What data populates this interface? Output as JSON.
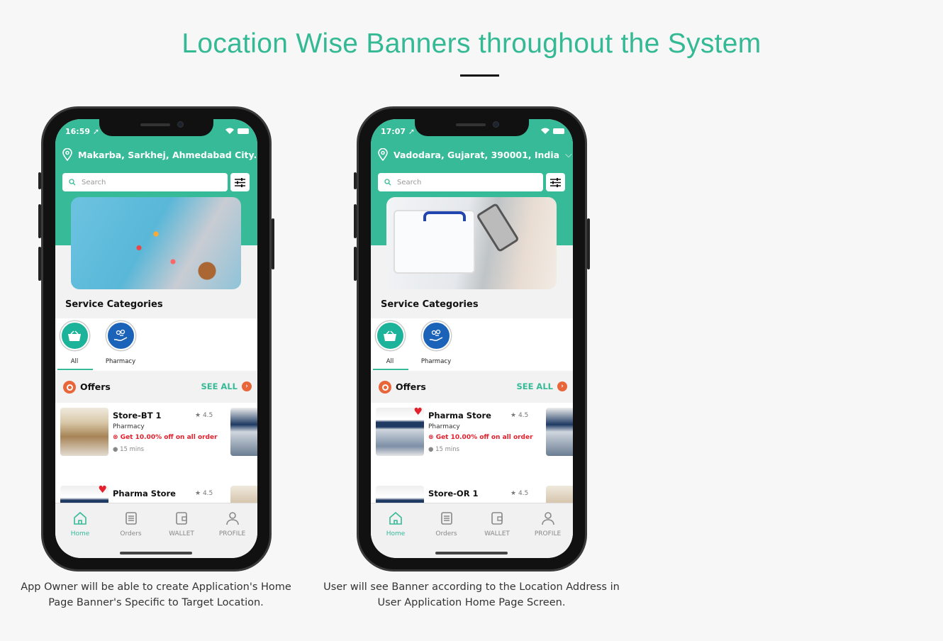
{
  "title": "Location Wise Banners throughout the System",
  "accent": "#37ba97",
  "offer_color": "#e3202c",
  "phones": [
    {
      "time": "16:59",
      "location": "Makarba, Sarkhej, Ahmedabad City...",
      "search_placeholder": "Search",
      "banner": "medicines-pills-banner",
      "service_categories": "Service Categories",
      "categories": [
        {
          "label": "All",
          "icon": "basket-icon",
          "selected": true
        },
        {
          "label": "Pharmacy",
          "icon": "pharmacy-hand-icon"
        }
      ],
      "offers": "Offers",
      "see_all": "SEE ALL",
      "stores": [
        {
          "name": "Store-BT 1",
          "rating": "4.5",
          "type": "Pharmacy",
          "offer": "Get 10.00% off on all order",
          "time": "15 mins",
          "favorite": false
        },
        {
          "name": "Pharma Store",
          "rating": "4.5",
          "favorite": true
        }
      ],
      "nav": [
        "Home",
        "Orders",
        "WALLET",
        "PROFILE"
      ],
      "caption": "App Owner will be able to create Application's Home Page Banner's Specific to Target Location."
    },
    {
      "time": "17:07",
      "location": "Vadodara, Gujarat, 390001, India",
      "search_placeholder": "Search",
      "banner": "medical-box-phone-banner",
      "service_categories": "Service Categories",
      "categories": [
        {
          "label": "All",
          "icon": "basket-icon",
          "selected": true
        },
        {
          "label": "Pharmacy",
          "icon": "pharmacy-hand-icon"
        }
      ],
      "offers": "Offers",
      "see_all": "SEE ALL",
      "stores": [
        {
          "name": "Pharma Store",
          "rating": "4.5",
          "type": "Pharmacy",
          "offer": "Get 10.00% off on all order",
          "time": "15 mins",
          "favorite": true
        },
        {
          "name": "Store-OR 1",
          "rating": "4.5",
          "favorite": false
        }
      ],
      "nav": [
        "Home",
        "Orders",
        "WALLET",
        "PROFILE"
      ],
      "caption": "User will see Banner according to the Location Address in User Application Home Page Screen."
    }
  ]
}
